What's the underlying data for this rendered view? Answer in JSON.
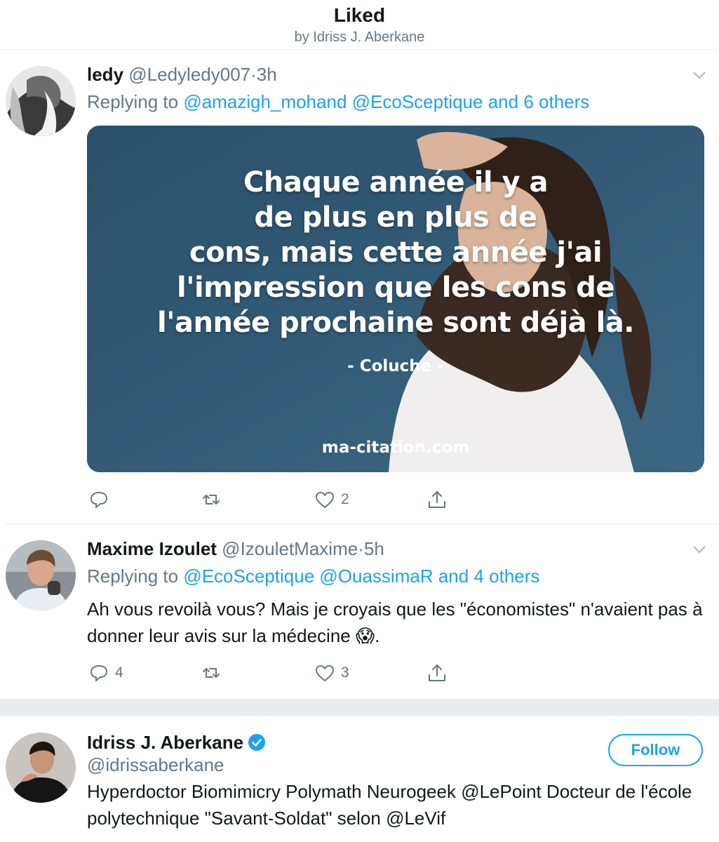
{
  "header": {
    "title": "Liked",
    "subtitle": "by Idriss J. Aberkane"
  },
  "tweets": [
    {
      "name": "ledy",
      "handle": "@Ledyledy007",
      "separator": "·",
      "time": "3h",
      "replying_prefix": "Replying to",
      "reply_mentions": [
        "@amazigh_mohand",
        "@EcoSceptique"
      ],
      "reply_and": "and",
      "reply_others": "6 others",
      "media": {
        "quote_lines": [
          "Chaque année il y a",
          "de plus en plus de",
          "cons, mais cette année j'ai",
          "l'impression que les cons de",
          "l'année prochaine sont déjà là."
        ],
        "author": "- Coluche -",
        "site": "ma-citation.com"
      },
      "actions": {
        "replies": "",
        "retweets": "",
        "likes": "2"
      }
    },
    {
      "name": "Maxime Izoulet",
      "handle": "@IzouletMaxime",
      "separator": "·",
      "time": "5h",
      "replying_prefix": "Replying to",
      "reply_mentions": [
        "@EcoSceptique",
        "@OuassimaR"
      ],
      "reply_and": "and",
      "reply_others": "4 others",
      "text": "Ah vous revoilà vous? Mais je croyais que les \"économistes\" n'avaient pas à donner leur avis sur la médecine 😱.",
      "actions": {
        "replies": "4",
        "retweets": "",
        "likes": "3"
      }
    }
  ],
  "profile": {
    "name": "Idriss J. Aberkane",
    "handle": "@idrissaberkane",
    "verified": true,
    "follow_label": "Follow",
    "bio": "Hyperdoctor Biomimicry Polymath Neurogeek @LePoint Docteur de l'école polytechnique \"Savant-Soldat\" selon @LeVif"
  },
  "colors": {
    "accent": "#1da1f2",
    "secondary_text": "#657786",
    "border": "#e6ecf0"
  },
  "icons": [
    "reply-icon",
    "retweet-icon",
    "like-icon",
    "share-icon",
    "chevron-down-icon",
    "verified-badge-icon"
  ]
}
